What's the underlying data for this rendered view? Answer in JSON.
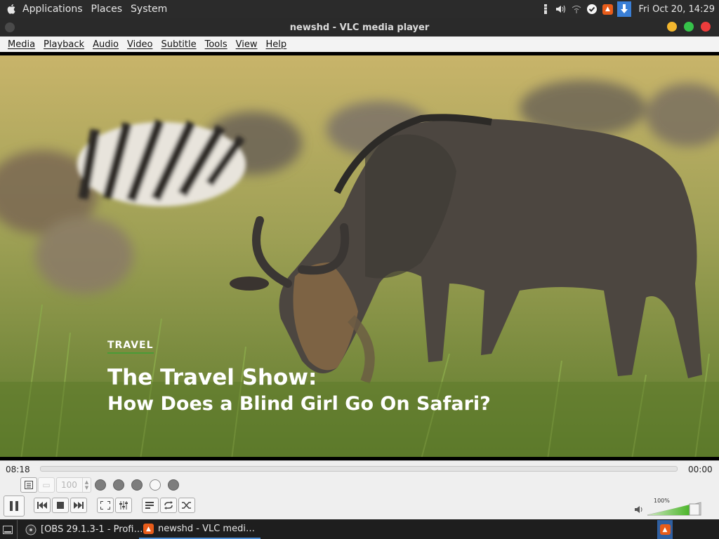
{
  "top_panel": {
    "menus": [
      "Applications",
      "Places",
      "System"
    ],
    "clock": "Fri Oct 20, 14:29",
    "tray_icons": [
      "keyboard-icon",
      "volume-icon",
      "network-icon",
      "check-icon",
      "vlc-icon",
      "download-icon"
    ]
  },
  "window": {
    "title": "newshd - VLC media player",
    "buttons": {
      "minimize_color": "#f2b62e",
      "maximize_color": "#36c24a",
      "close_color": "#ec3c3c"
    }
  },
  "menubar": [
    "Media",
    "Playback",
    "Audio",
    "Video",
    "Subtitle",
    "Tools",
    "View",
    "Help"
  ],
  "video": {
    "category": "TRAVEL",
    "title_line1": "The Travel Show:",
    "title_line2": "How Does a Blind Girl Go On Safari?"
  },
  "controls": {
    "elapsed": "08:18",
    "total": "00:00",
    "playback_speed": "100",
    "volume": "100%",
    "volume_level": 1.0
  },
  "taskbar": {
    "items": [
      "[OBS 29.1.3-1 - Profi…",
      "newshd - VLC medi…"
    ]
  }
}
